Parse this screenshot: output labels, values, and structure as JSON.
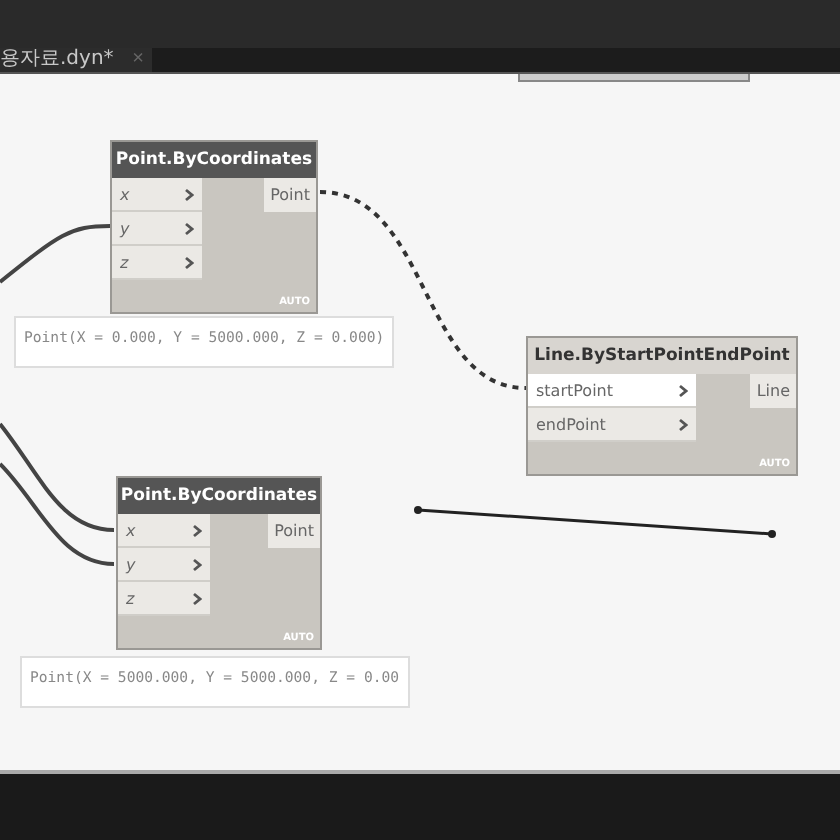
{
  "tab": {
    "title": "용자료.dyn*",
    "close": "×"
  },
  "nodes": [
    {
      "title": "Point.ByCoordinates",
      "active": false,
      "inputs": [
        {
          "label": "x",
          "highlighted": false
        },
        {
          "label": "y",
          "highlighted": false
        },
        {
          "label": "z",
          "highlighted": false
        }
      ],
      "outputs": [
        "Point"
      ],
      "lacing": "AUTO",
      "preview": "Point(X = 0.000, Y = 5000.000, Z = 0.000)"
    },
    {
      "title": "Point.ByCoordinates",
      "active": false,
      "inputs": [
        {
          "label": "x",
          "highlighted": false
        },
        {
          "label": "y",
          "highlighted": false
        },
        {
          "label": "z",
          "highlighted": false
        }
      ],
      "outputs": [
        "Point"
      ],
      "lacing": "AUTO",
      "preview": "Point(X = 5000.000, Y = 5000.000, Z = 0.00"
    },
    {
      "title": "Line.ByStartPointEndPoint",
      "active": true,
      "inputs": [
        {
          "label": "startPoint",
          "highlighted": true
        },
        {
          "label": "endPoint",
          "highlighted": false
        }
      ],
      "outputs": [
        "Line"
      ],
      "lacing": "AUTO"
    }
  ]
}
